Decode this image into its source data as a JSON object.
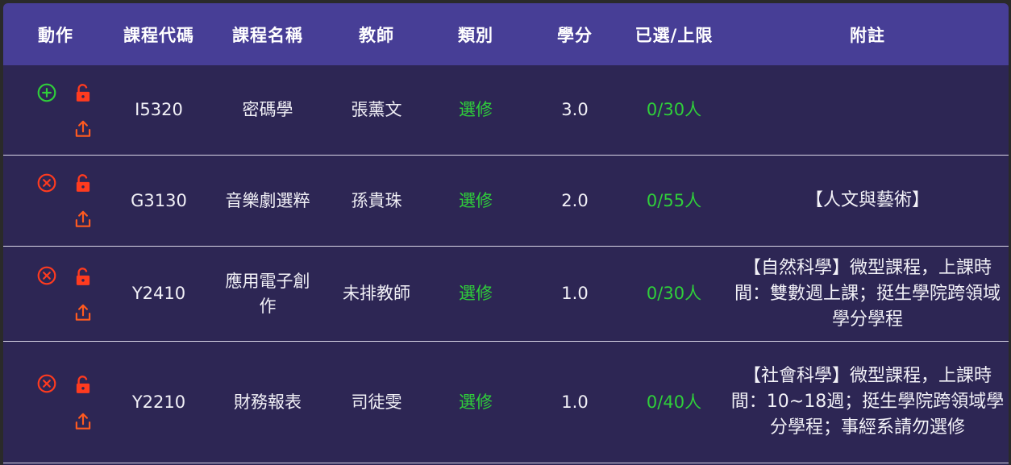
{
  "header": {
    "action": "動作",
    "code": "課程代碼",
    "name": "課程名稱",
    "teacher": "教師",
    "type": "類別",
    "credit": "學分",
    "quota": "已選/上限",
    "note": "附註"
  },
  "colors": {
    "header_bg": "#473e96",
    "body_bg": "#2d2654",
    "accent_green": "#2fcf3a",
    "icon_red": "#ff3b1f",
    "icon_orange": "#ff5a1f"
  },
  "icons": {
    "add": "plus-circle-icon",
    "remove": "x-circle-icon",
    "lock": "unlock-icon",
    "share": "share-upload-icon"
  },
  "rows": [
    {
      "code": "I5320",
      "name": "密碼學",
      "teacher": "張薰文",
      "type": "選修",
      "credit": "3.0",
      "quota": "0/30人",
      "note": "",
      "primary_action": "add"
    },
    {
      "code": "G3130",
      "name": "音樂劇選粹",
      "teacher": "孫貴珠",
      "type": "選修",
      "credit": "2.0",
      "quota": "0/55人",
      "note": "【人文與藝術】",
      "primary_action": "remove"
    },
    {
      "code": "Y2410",
      "name": "應用電子創作",
      "teacher": "未排教師",
      "type": "選修",
      "credit": "1.0",
      "quota": "0/30人",
      "note": "【自然科學】微型課程，上課時間：雙數週上課；挺生學院跨領域學分學程",
      "primary_action": "remove"
    },
    {
      "code": "Y2210",
      "name": "財務報表",
      "teacher": "司徒雯",
      "type": "選修",
      "credit": "1.0",
      "quota": "0/40人",
      "note": "【社會科學】微型課程，上課時間：10~18週；挺生學院跨領域學分學程；事經系請勿選修",
      "primary_action": "remove"
    }
  ]
}
